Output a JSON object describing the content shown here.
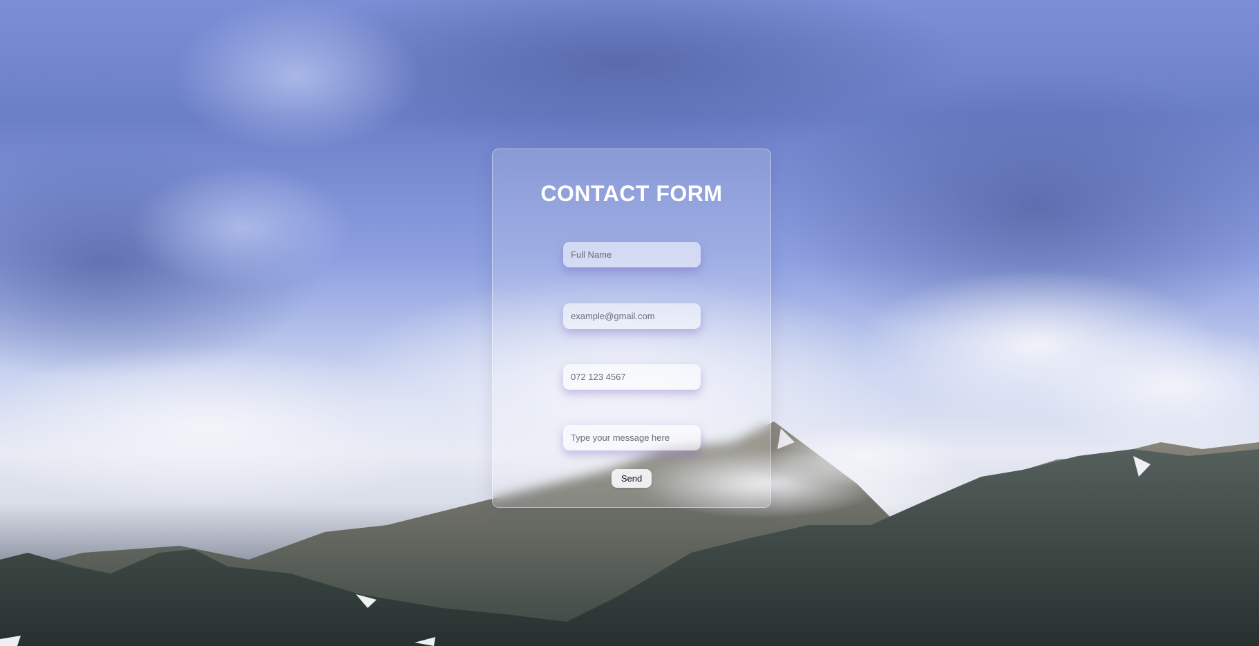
{
  "form": {
    "title": "CONTACT FORM",
    "name_placeholder": "Full Name",
    "email_placeholder": "example@gmail.com",
    "phone_placeholder": "072 123 4567",
    "message_placeholder": "Type your message here",
    "send_label": "Send"
  },
  "background": {
    "scene": "mountain-landscape-image",
    "sky_color": "#7083cf",
    "cloud_color": "#e9ecf5",
    "mountain_color": "#3d4a48"
  }
}
